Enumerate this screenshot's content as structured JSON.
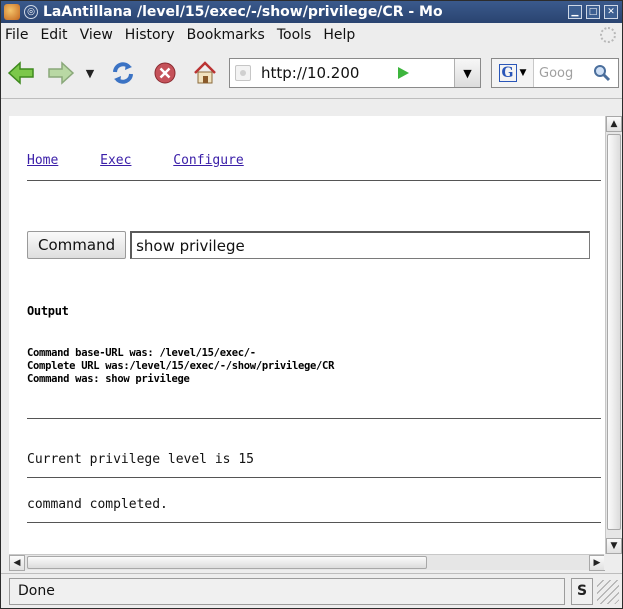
{
  "window": {
    "title": "LaAntillana /level/15/exec/-/show/privilege/CR - Mo"
  },
  "menubar": {
    "items": [
      "File",
      "Edit",
      "View",
      "History",
      "Bookmarks",
      "Tools",
      "Help"
    ]
  },
  "navbar": {
    "url": "http://10.200",
    "search_placeholder": "Goog"
  },
  "content": {
    "links": [
      "Home",
      "Exec",
      "Configure"
    ],
    "command_button_label": "Command",
    "command_value": "show privilege",
    "output_heading": "Output",
    "info_lines": [
      "Command base-URL was: /level/15/exec/-",
      "Complete URL was:/level/15/exec/-/show/privilege/CR",
      "Command was: show privilege"
    ],
    "result_line": "Current privilege level is 15",
    "completed_line": "command completed."
  },
  "statusbar": {
    "text": "Done",
    "ext_label": "S"
  },
  "colors": {
    "titlebar": "#2f4d7e",
    "link": "#3a1ea8",
    "go_arrow": "#3db53d"
  }
}
